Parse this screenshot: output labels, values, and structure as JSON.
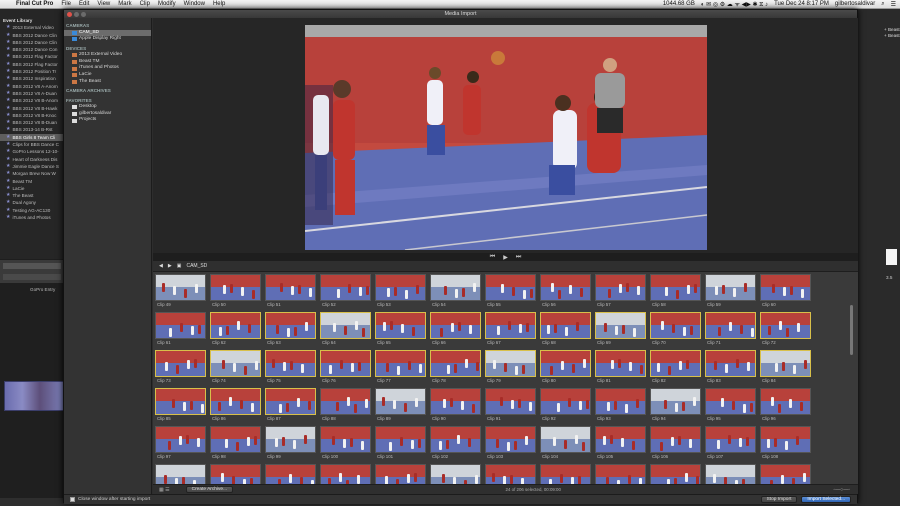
{
  "menubar": {
    "app": "Final Cut Pro",
    "items": [
      "File",
      "Edit",
      "View",
      "Mark",
      "Clip",
      "Modify",
      "Window",
      "Help"
    ],
    "disk": "1044.68 GB",
    "datetime": "Tue Dec 24  8:17 PM",
    "user": "gilbertosaldivar"
  },
  "fcp_library": {
    "header": "Event Library",
    "items": [
      "2013 External Video",
      "BBS 2012 Dance Clin",
      "BBS 2012 Dance Clin",
      "BBS 2012 Dance Con",
      "BBS 2012 Flag Factor",
      "BBS 2012 Flag Factor",
      "BBS 2012 Position Tr",
      "BBS 2012 Inspiration",
      "BBS 2012 V8 A-Anom",
      "BBS 2012 V8 A-Duan",
      "BBS 2012 V8 B-Anom",
      "BBS 2012 V8 B-Hawk",
      "BBS 2012 V8 B-Knoc",
      "BBS 2012 V8 B-Duan",
      "BBS 2013-14 B-Rst",
      "BBS Girls 8 Team Cli",
      "Clips for BBS Dance C",
      "GoPro Lessons 12-10-",
      "Heart of Darkness Dis",
      "Jimmie Eagle Dance S",
      "Morgan Brew Now W",
      "Beast TM",
      "LaCie",
      "The Beast",
      "Dual Agony",
      "Testing AG-AC130",
      "iTunes and Photos"
    ],
    "selected_index": 15,
    "timeline_clip_label": "GoPro Entry"
  },
  "window": {
    "title": "Media Import",
    "sidebar": {
      "sections": [
        {
          "title": "CAMERAS",
          "items": [
            {
              "label": "CAM_SD",
              "selected": true
            },
            {
              "label": "Apple Display Right",
              "selected": false
            }
          ]
        },
        {
          "title": "DEVICES",
          "items": [
            {
              "label": "2013 External Video",
              "selected": false
            },
            {
              "label": "Beast TM",
              "selected": false
            },
            {
              "label": "iTunes and Photos",
              "selected": false
            },
            {
              "label": "LaCie",
              "selected": false
            },
            {
              "label": "The Beast",
              "selected": false
            }
          ]
        },
        {
          "title": "CAMERA ARCHIVES",
          "items": []
        },
        {
          "title": "FAVORITES",
          "items": [
            {
              "label": "Desktop",
              "selected": false
            },
            {
              "label": "gilbertosaldivar",
              "selected": false
            },
            {
              "label": "Projects",
              "selected": false
            }
          ]
        }
      ]
    },
    "browser": {
      "location": "CAM_SD",
      "clips": [
        {
          "label": "Clip 49",
          "sel": false
        },
        {
          "label": "Clip 50",
          "sel": false
        },
        {
          "label": "Clip 51",
          "sel": false
        },
        {
          "label": "Clip 52",
          "sel": false
        },
        {
          "label": "Clip 53",
          "sel": false
        },
        {
          "label": "Clip 54",
          "sel": false
        },
        {
          "label": "Clip 55",
          "sel": false
        },
        {
          "label": "Clip 56",
          "sel": false
        },
        {
          "label": "Clip 57",
          "sel": false
        },
        {
          "label": "Clip 58",
          "sel": false
        },
        {
          "label": "Clip 59",
          "sel": false
        },
        {
          "label": "Clip 60",
          "sel": false
        },
        {
          "label": "Clip 61",
          "sel": false
        },
        {
          "label": "Clip 62",
          "sel": true
        },
        {
          "label": "Clip 63",
          "sel": true
        },
        {
          "label": "Clip 64",
          "sel": true
        },
        {
          "label": "Clip 65",
          "sel": true
        },
        {
          "label": "Clip 66",
          "sel": true
        },
        {
          "label": "Clip 67",
          "sel": true
        },
        {
          "label": "Clip 68",
          "sel": true
        },
        {
          "label": "Clip 69",
          "sel": true
        },
        {
          "label": "Clip 70",
          "sel": true
        },
        {
          "label": "Clip 71",
          "sel": true
        },
        {
          "label": "Clip 72",
          "sel": true
        },
        {
          "label": "Clip 73",
          "sel": true
        },
        {
          "label": "Clip 74",
          "sel": true
        },
        {
          "label": "Clip 75",
          "sel": true
        },
        {
          "label": "Clip 76",
          "sel": true
        },
        {
          "label": "Clip 77",
          "sel": true
        },
        {
          "label": "Clip 78",
          "sel": true
        },
        {
          "label": "Clip 79",
          "sel": true
        },
        {
          "label": "Clip 80",
          "sel": true
        },
        {
          "label": "Clip 81",
          "sel": true
        },
        {
          "label": "Clip 82",
          "sel": true
        },
        {
          "label": "Clip 83",
          "sel": true
        },
        {
          "label": "Clip 84",
          "sel": true
        },
        {
          "label": "Clip 85",
          "sel": true
        },
        {
          "label": "Clip 86",
          "sel": true
        },
        {
          "label": "Clip 87",
          "sel": true
        },
        {
          "label": "Clip 88",
          "sel": false
        },
        {
          "label": "Clip 89",
          "sel": false
        },
        {
          "label": "Clip 90",
          "sel": false
        },
        {
          "label": "Clip 91",
          "sel": false
        },
        {
          "label": "Clip 92",
          "sel": false
        },
        {
          "label": "Clip 93",
          "sel": false
        },
        {
          "label": "Clip 94",
          "sel": false
        },
        {
          "label": "Clip 95",
          "sel": false
        },
        {
          "label": "Clip 96",
          "sel": false
        },
        {
          "label": "Clip 97",
          "sel": false
        },
        {
          "label": "Clip 98",
          "sel": false
        },
        {
          "label": "Clip 99",
          "sel": false
        },
        {
          "label": "Clip 100",
          "sel": false
        },
        {
          "label": "Clip 101",
          "sel": false
        },
        {
          "label": "Clip 102",
          "sel": false
        },
        {
          "label": "Clip 103",
          "sel": false
        },
        {
          "label": "Clip 104",
          "sel": false
        },
        {
          "label": "Clip 105",
          "sel": false
        },
        {
          "label": "Clip 106",
          "sel": false
        },
        {
          "label": "Clip 107",
          "sel": false
        },
        {
          "label": "Clip 108",
          "sel": false
        },
        {
          "label": "",
          "sel": false
        },
        {
          "label": "",
          "sel": false
        },
        {
          "label": "",
          "sel": false
        },
        {
          "label": "",
          "sel": false
        },
        {
          "label": "",
          "sel": false
        },
        {
          "label": "",
          "sel": false
        },
        {
          "label": "",
          "sel": false
        },
        {
          "label": "",
          "sel": false
        },
        {
          "label": "",
          "sel": false
        },
        {
          "label": "",
          "sel": false
        },
        {
          "label": "",
          "sel": false
        },
        {
          "label": "",
          "sel": false
        }
      ],
      "create_archive_label": "Create Archive...",
      "status": "24 of 206 selected, 00:09:00"
    },
    "bottom": {
      "close_window_label": "Close window after starting import",
      "close_window_checked": false,
      "stop_import_label": "Stop Import",
      "import_selected_label": "Import Selected..."
    }
  },
  "right_panel": {
    "lines": [
      "+ Beast",
      "+ Beast"
    ],
    "zoom": "3.5"
  },
  "colors": {
    "selected_border": "#d8c04a",
    "primary_button": "#2f64b4",
    "court_wall": "#b8413b",
    "court_floor": "#5f6eb5"
  }
}
